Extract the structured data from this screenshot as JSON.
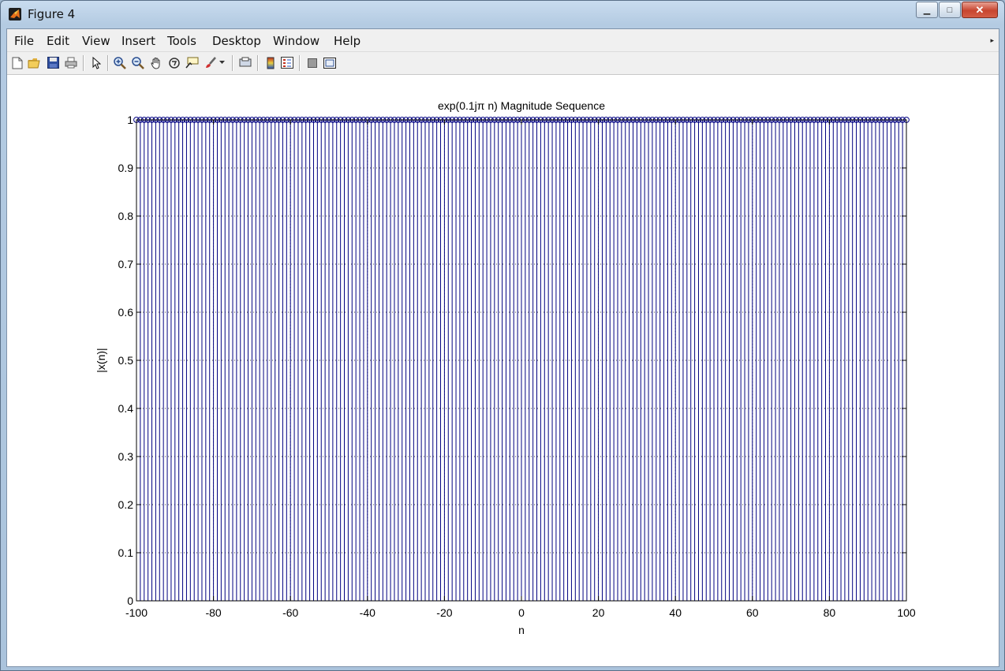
{
  "window": {
    "title": "Figure 4",
    "minimize_symbol": "▁",
    "maximize_symbol": "□",
    "close_symbol": "✕"
  },
  "menu": {
    "items": [
      "File",
      "Edit",
      "View",
      "Insert",
      "Tools",
      "Desktop",
      "Window",
      "Help"
    ],
    "overflow_symbol": "▸"
  },
  "toolbar": {
    "icons": [
      "new-figure-icon",
      "open-file-icon",
      "save-icon",
      "print-icon",
      "edit-plot-arrow-icon",
      "zoom-in-icon",
      "zoom-out-icon",
      "pan-hand-icon",
      "rotate-3d-icon",
      "data-cursor-icon",
      "brush-icon",
      "brush-dropdown-icon",
      "link-plot-icon",
      "insert-colorbar-icon",
      "insert-legend-icon",
      "hide-plot-tools-icon",
      "show-plot-tools-icon"
    ]
  },
  "colors": {
    "stem": "#000080",
    "axes": "#000000",
    "grid": "#000000"
  },
  "chart_data": {
    "type": "stem",
    "title": "exp(0.1jπ n) Magnitude Sequence",
    "xlabel": "n",
    "ylabel": "|x(n)|",
    "xlim": [
      -100,
      100
    ],
    "ylim": [
      0,
      1
    ],
    "xticks": [
      "-100",
      "-80",
      "-60",
      "-40",
      "-20",
      "0",
      "20",
      "40",
      "60",
      "80",
      "100"
    ],
    "yticks": [
      "0",
      "0.1",
      "0.2",
      "0.3",
      "0.4",
      "0.5",
      "0.6",
      "0.7",
      "0.8",
      "0.9",
      "1"
    ],
    "grid": "on",
    "marker": "circle",
    "series": [
      {
        "n_start": -100,
        "n_end": 100,
        "n_step": 1,
        "value": 1
      }
    ]
  }
}
